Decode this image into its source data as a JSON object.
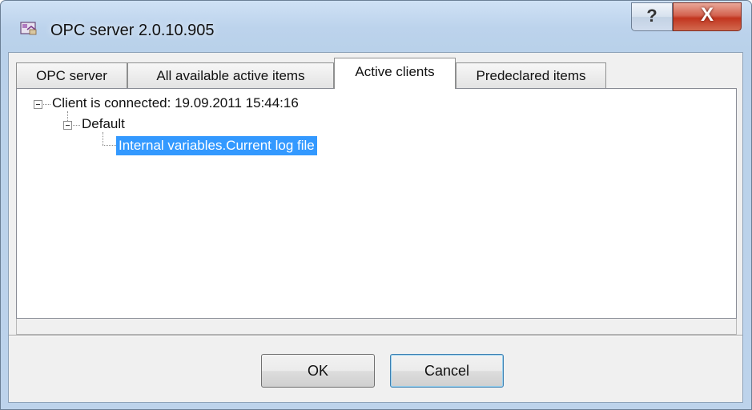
{
  "window": {
    "title": "OPC server 2.0.10.905",
    "help_glyph": "?",
    "close_glyph": "X"
  },
  "tabs": [
    {
      "label": "OPC server"
    },
    {
      "label": "All available active items"
    },
    {
      "label": "Active clients"
    },
    {
      "label": "Predeclared items"
    }
  ],
  "active_tab": "Active clients",
  "tree": {
    "client": "Client is connected: 19.09.2011 15:44:16",
    "group": "Default",
    "item": "Internal variables.Current log file"
  },
  "buttons": {
    "ok": "OK",
    "cancel": "Cancel"
  },
  "colors": {
    "selection": "#3399ff",
    "close_button": "#c2351f",
    "titlebar": "#bcd3ec"
  },
  "icons": [
    "app-icon",
    "help-icon",
    "close-icon",
    "collapse-icon"
  ]
}
